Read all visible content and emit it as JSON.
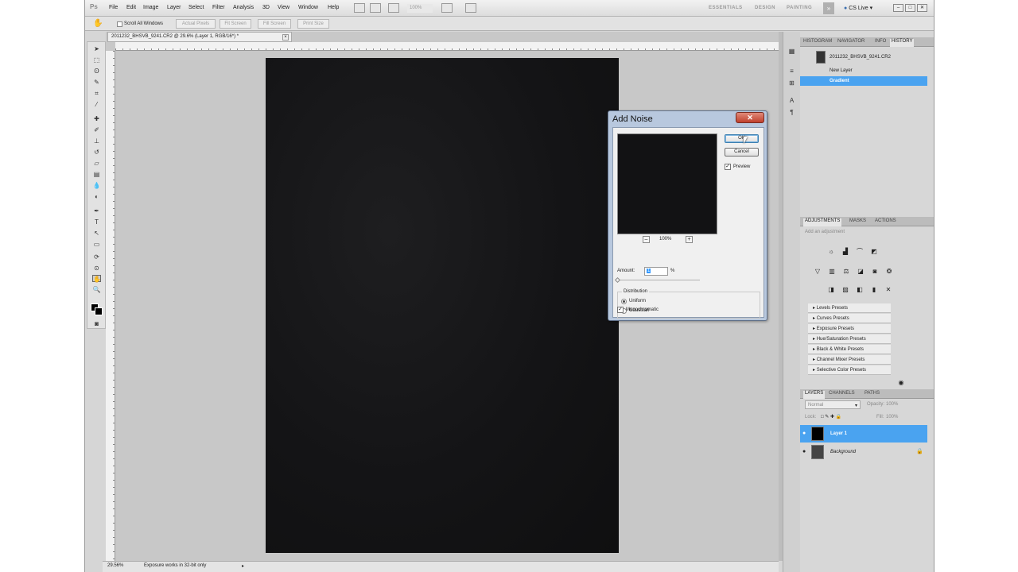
{
  "app": {
    "logo": "Ps"
  },
  "menu": [
    "File",
    "Edit",
    "Image",
    "Layer",
    "Select",
    "Filter",
    "Analysis",
    "3D",
    "View",
    "Window",
    "Help"
  ],
  "toolbar": {
    "zoom_value": "100%"
  },
  "workspaces": [
    "ESSENTIALS",
    "DESIGN",
    "PAINTING"
  ],
  "cs_live": "CS Live",
  "options": {
    "scroll_all": "Scroll All Windows",
    "buttons": [
      "Actual Pixels",
      "Fit Screen",
      "Fill Screen",
      "Print Size"
    ]
  },
  "document": {
    "tab_title": "2011232_BHSVB_9241.CR2 @ 29.6% (Layer 1, RGB/16*) *",
    "zoom": "29.56%",
    "status": "Exposure works in 32-bit only"
  },
  "panels": {
    "top_tabs": [
      "HISTOGRAM",
      "NAVIGATOR",
      "INFO",
      "HISTORY"
    ],
    "history": {
      "snapshot": "2011232_BHSVB_9241.CR2",
      "items": [
        "New Layer",
        "Gradient"
      ]
    },
    "mid_tabs": [
      "ADJUSTMENTS",
      "MASKS",
      "ACTIONS"
    ],
    "adjustments_hint": "Add an adjustment",
    "presets": [
      "Levels Presets",
      "Curves Presets",
      "Exposure Presets",
      "Hue/Saturation Presets",
      "Black & White Presets",
      "Channel Mixer Presets",
      "Selective Color Presets"
    ],
    "layer_tabs": [
      "LAYERS",
      "CHANNELS",
      "PATHS"
    ],
    "blend_mode": "Normal",
    "opacity_label": "Opacity:",
    "opacity": "100%",
    "lock_label": "Lock:",
    "fill_label": "Fill:",
    "fill": "100%",
    "layers": [
      "Layer 1",
      "Background"
    ]
  },
  "dialog": {
    "title": "Add Noise",
    "ok": "OK",
    "cancel": "Cancel",
    "preview_label": "Preview",
    "preview_zoom": "100%",
    "amount_label": "Amount:",
    "amount_value": "1",
    "amount_unit": "%",
    "distribution_label": "Distribution",
    "options": [
      "Uniform",
      "Gaussian"
    ],
    "monochromatic_label": "Monochromatic"
  },
  "colors": {
    "accent": "#3399ff",
    "canvas": "#141416",
    "selection": "#4aa3f0"
  }
}
